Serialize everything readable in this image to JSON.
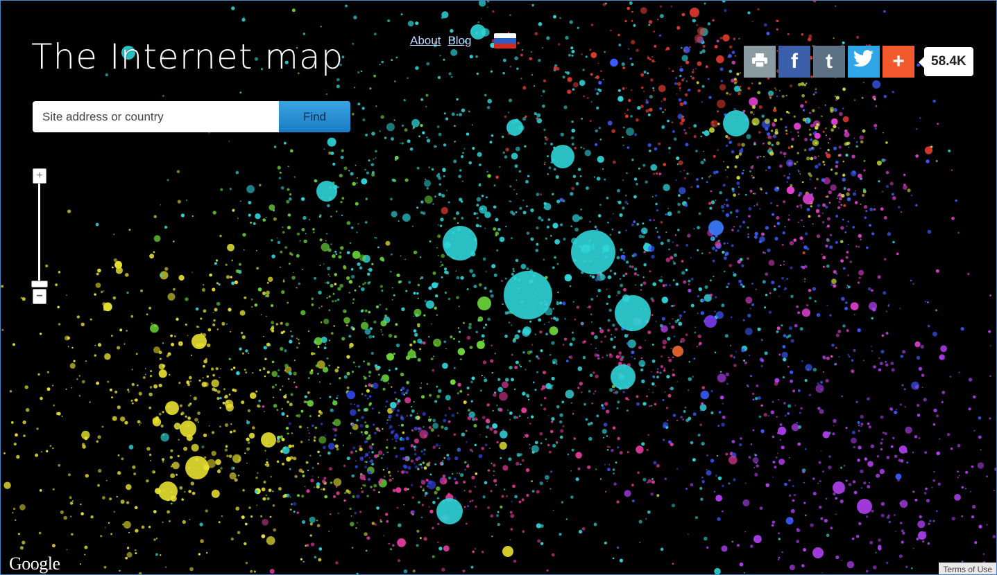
{
  "title": "The Internet map",
  "nav": {
    "about": "About",
    "blog": "Blog",
    "language_flag_icon": "russian-flag-icon"
  },
  "search": {
    "placeholder": "Site address or country",
    "button": "Find"
  },
  "zoom": {
    "plus": "+",
    "minus": "−",
    "level": 0.05
  },
  "share": {
    "buttons": [
      {
        "name": "print",
        "icon": "print-icon",
        "color": "#8a9ba2"
      },
      {
        "name": "facebook",
        "label": "f",
        "color": "#3b5fa8"
      },
      {
        "name": "tumblr",
        "label": "t",
        "color": "#5d7184"
      },
      {
        "name": "twitter",
        "icon": "twitter-bird-icon",
        "color": "#2ea6e8"
      },
      {
        "name": "more",
        "label": "+",
        "color": "#f25a2e"
      }
    ],
    "count": "58.4K"
  },
  "footer": {
    "google": "Google",
    "terms": "Terms of Use"
  }
}
